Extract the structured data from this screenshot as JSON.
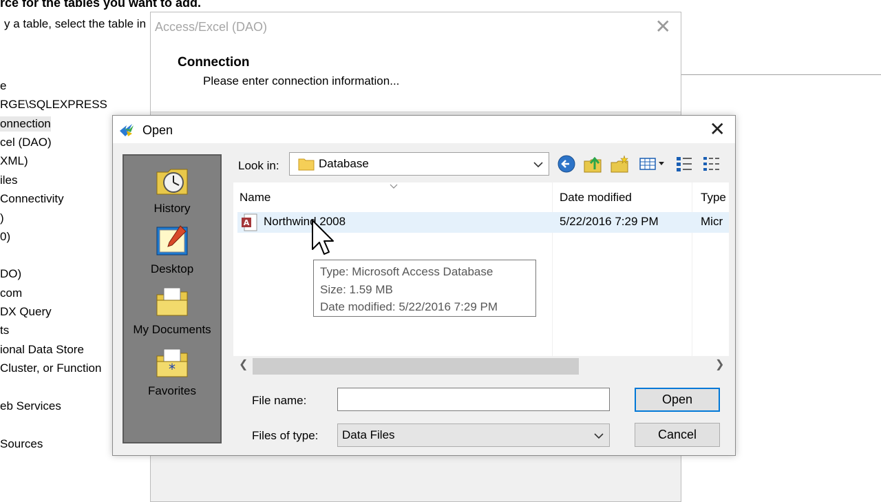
{
  "background_window": {
    "header": "rce for the tables you want to add.",
    "subheader": "y a table, select the table in",
    "source_list": [
      "e",
      "RGE\\SQLEXPRESS",
      "onnection",
      "cel (DAO)",
      "XML)",
      "iles",
      " Connectivity",
      ")",
      "0)",
      "",
      "DO)",
      "com",
      "DX Query",
      "ts",
      "ional Data Store",
      " Cluster, or Function",
      "",
      "eb Services",
      "",
      "Sources"
    ]
  },
  "dao_dialog": {
    "title": "Access/Excel (DAO)",
    "close_glyph": "✕",
    "heading": "Connection",
    "subheading": "Please enter connection information..."
  },
  "open_dialog": {
    "title": "Open",
    "close_glyph": "✕",
    "places": [
      {
        "label": "History",
        "icon": "history-icon"
      },
      {
        "label": "Desktop",
        "icon": "desktop-icon"
      },
      {
        "label": "My Documents",
        "icon": "my-documents-icon"
      },
      {
        "label": "Favorites",
        "icon": "favorites-icon"
      }
    ],
    "look_in_label": "Look in:",
    "look_in_value": "Database",
    "toolbar_icons": [
      "back-icon",
      "up-folder-icon",
      "new-folder-icon",
      "view-menu-icon",
      "list-view-icon",
      "details-view-icon"
    ],
    "columns": {
      "name": "Name",
      "date": "Date modified",
      "type": "Type"
    },
    "files": [
      {
        "name": "Northwind 2008",
        "date": "5/22/2016 7:29 PM",
        "type": "Micr",
        "icon": "access-file-icon"
      }
    ],
    "tooltip": {
      "type": "Type: Microsoft Access Database",
      "size": "Size: 1.59 MB",
      "date": "Date modified: 5/22/2016 7:29 PM"
    },
    "file_name_label": "File name:",
    "file_name_value": "",
    "files_of_type_label": "Files of type:",
    "files_of_type_value": "Data Files",
    "open_button": "Open",
    "cancel_button": "Cancel"
  },
  "colors": {
    "selection": "#e5f1fb",
    "accent": "#0078d7",
    "places_bar": "#808080"
  }
}
